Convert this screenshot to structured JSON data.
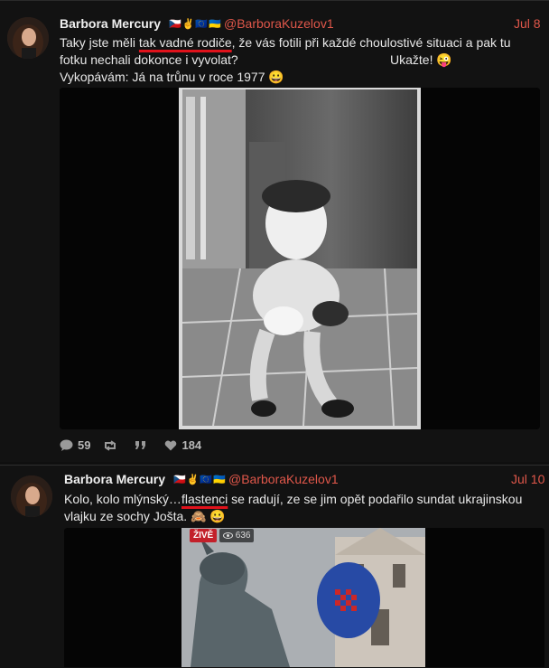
{
  "tweets": [
    {
      "name": "Barbora Mercury",
      "flags": "🇨🇿✌️🇪🇺🇺🇦",
      "handle": "@BarboraKuzelov1",
      "date": "Jul 8",
      "line1_pre": "Taky jste měli ",
      "line1_ul": "tak vadné rodiče",
      "line1_post": ", že vás fotili při každé choulostivé situaci a pak tu",
      "line2": "fotku nechali dokonce i vyvolat?",
      "line2_right": "Ukažte! 😜",
      "line3": "Vykopávám: Já na trůnu v roce 1977 😀",
      "stats": {
        "replies": "59",
        "retweets": "",
        "quotes": "",
        "likes": "184"
      }
    },
    {
      "name": "Barbora Mercury",
      "flags": "🇨🇿✌️🇪🇺🇺🇦",
      "handle": "@BarboraKuzelov1",
      "date": "Jul 10",
      "line1_pre": "Kolo, kolo mlýnský…",
      "line1_ul": "flastenci",
      "line1_post": " se radují, ze se jim opět podařilo sundat ukrajinskou",
      "line2": "vlajku ze sochy Jošta. 🙈 😀",
      "live_label": "ŽIVĚ",
      "view_count": "636"
    }
  ],
  "icons": {
    "reply": "speech-bubble-icon",
    "retweet": "retweet-icon",
    "quote": "quote-icon",
    "like": "heart-icon",
    "views": "eye-icon"
  },
  "colors": {
    "background": "#121212",
    "accent": "#e0574a",
    "underline": "#e0121b"
  }
}
